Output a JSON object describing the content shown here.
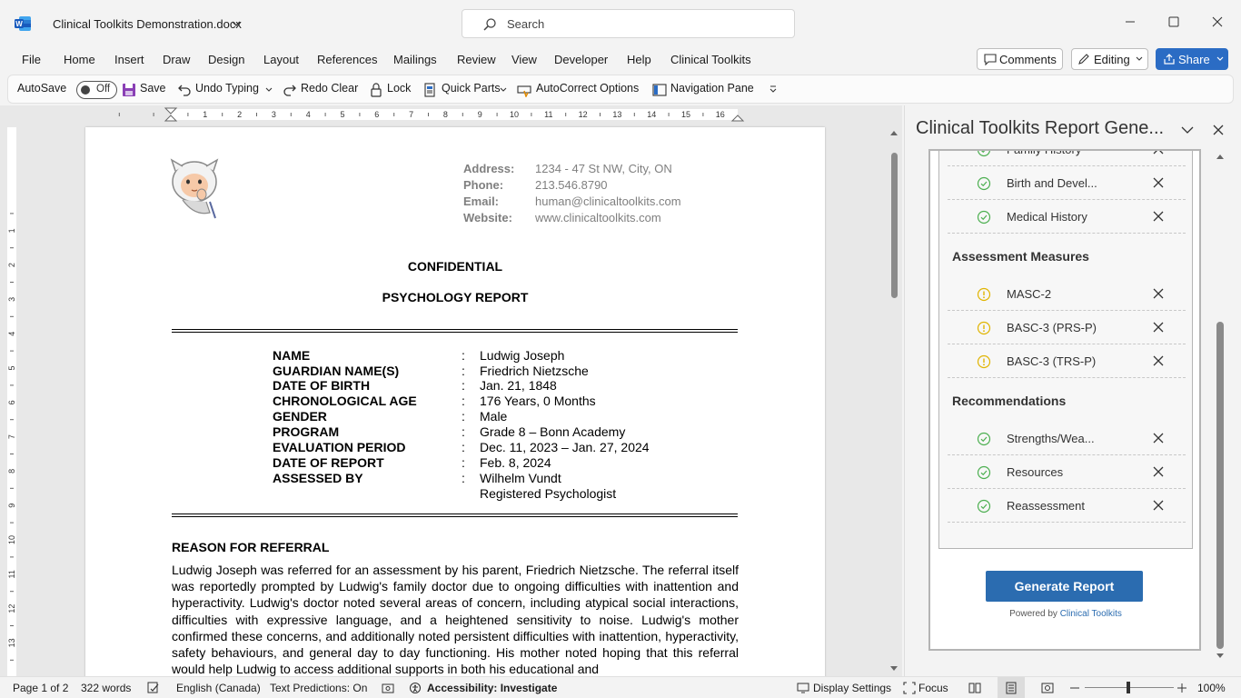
{
  "app": {
    "title": "Clinical Toolkits Demonstration.docx",
    "search_placeholder": "Search"
  },
  "menu": {
    "tabs": [
      "File",
      "Home",
      "Insert",
      "Draw",
      "Design",
      "Layout",
      "References",
      "Mailings",
      "Review",
      "View",
      "Developer",
      "Help",
      "Clinical Toolkits"
    ],
    "comments": "Comments",
    "editing": "Editing",
    "share": "Share"
  },
  "toolbar": {
    "autosave": "AutoSave",
    "autosave_state": "Off",
    "save": "Save",
    "undo": "Undo Typing",
    "redo": "Redo Clear",
    "lock": "Lock",
    "quick_parts": "Quick Parts",
    "autocorrect": "AutoCorrect Options",
    "nav_pane": "Navigation Pane"
  },
  "ruler": {
    "marks": [
      "1",
      "2",
      "3",
      "4",
      "5",
      "6",
      "7",
      "8",
      "9",
      "10",
      "11",
      "12",
      "13",
      "14",
      "15",
      "16"
    ],
    "vmarks": [
      "1",
      "2",
      "3",
      "4",
      "5",
      "6",
      "7",
      "8",
      "9",
      "10",
      "11",
      "12",
      "13",
      "14"
    ]
  },
  "document": {
    "contact": [
      {
        "label": "Address:",
        "value": "1234 - 47 St NW, City, ON"
      },
      {
        "label": "Phone:",
        "value": "213.546.8790"
      },
      {
        "label": "Email:",
        "value": "human@clinicaltoolkits.com"
      },
      {
        "label": "Website:",
        "value": "www.clinicaltoolkits.com"
      }
    ],
    "confidential": "CONFIDENTIAL",
    "report_title": "PSYCHOLOGY REPORT",
    "colon": ":",
    "info": [
      {
        "label": "NAME",
        "value": "Ludwig Joseph"
      },
      {
        "label": "GUARDIAN NAME(S)",
        "value": "Friedrich Nietzsche"
      },
      {
        "label": "DATE OF BIRTH",
        "value": "Jan. 21, 1848"
      },
      {
        "label": "CHRONOLOGICAL AGE",
        "value": "176 Years, 0 Months"
      },
      {
        "label": "GENDER",
        "value": "Male"
      },
      {
        "label": "PROGRAM",
        "value": "Grade 8 – Bonn Academy"
      },
      {
        "label": "EVALUATION PERIOD",
        "value": "Dec. 11, 2023 – Jan. 27, 2024"
      },
      {
        "label": "DATE OF REPORT",
        "value": "Feb. 8, 2024"
      },
      {
        "label": "ASSESSED BY",
        "value": "Wilhelm Vundt"
      }
    ],
    "assessor_title": "Registered Psychologist",
    "section_heading": "REASON FOR REFERRAL",
    "body": "Ludwig Joseph was referred for an assessment by his parent, Friedrich Nietzsche. The referral itself was reportedly prompted by Ludwig's family doctor due to ongoing difficulties with inattention and hyperactivity. Ludwig's doctor noted several areas of concern, including atypical social interactions, difficulties with expressive language, and a heightened sensitivity to noise. Ludwig's mother confirmed these concerns, and additionally noted persistent difficulties with inattention, hyperactivity, safety behaviours, and general day to day functioning. His mother noted hoping that this referral would help Ludwig to access additional supports in both his educational and"
  },
  "pane": {
    "title": "Clinical Toolkits Report Gene...",
    "top_items": [
      {
        "label": "Family History",
        "status": "ok"
      },
      {
        "label": "Birth and Devel...",
        "status": "ok"
      },
      {
        "label": "Medical History",
        "status": "ok"
      }
    ],
    "assessment_heading": "Assessment Measures",
    "assessment_items": [
      {
        "label": "MASC-2",
        "status": "warn"
      },
      {
        "label": "BASC-3 (PRS-P)",
        "status": "warn"
      },
      {
        "label": "BASC-3 (TRS-P)",
        "status": "warn"
      }
    ],
    "recommendations_heading": "Recommendations",
    "recommendation_items": [
      {
        "label": "Strengths/Wea...",
        "status": "ok"
      },
      {
        "label": "Resources",
        "status": "ok"
      },
      {
        "label": "Reassessment",
        "status": "ok"
      }
    ],
    "generate": "Generate Report",
    "powered_by": "Powered by",
    "powered_link": "Clinical Toolkits"
  },
  "status": {
    "page": "Page 1 of 2",
    "words": "322 words",
    "language": "English (Canada)",
    "predictions": "Text Predictions: On",
    "accessibility": "Accessibility: Investigate",
    "display": "Display Settings",
    "focus": "Focus",
    "zoom": "100%"
  },
  "colors": {
    "accent": "#2b6cc4",
    "ok": "#4caf50",
    "warn": "#e0b400"
  },
  "icons": [
    "word-logo-icon",
    "search-icon",
    "save-icon",
    "undo-icon",
    "redo-icon",
    "lock-icon",
    "quick-parts-icon",
    "autocorrect-icon",
    "navigation-pane-icon",
    "comment-icon",
    "pencil-icon",
    "share-icon",
    "check-circle-icon",
    "warning-circle-icon",
    "close-icon"
  ]
}
